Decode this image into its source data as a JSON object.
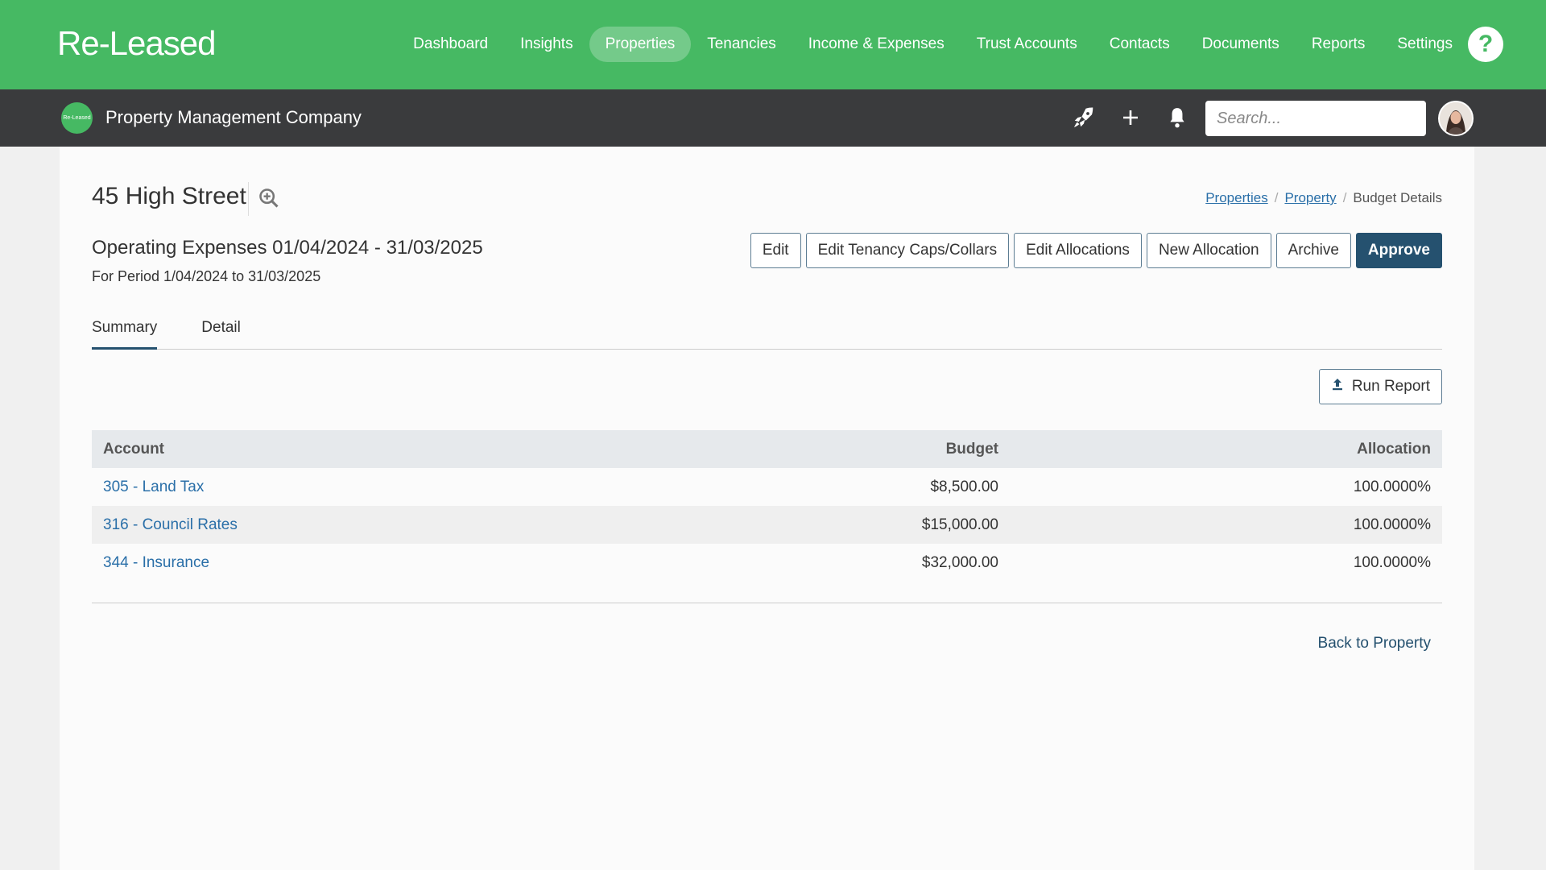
{
  "app": {
    "logo": "Re-Leased",
    "nav": [
      {
        "label": "Dashboard"
      },
      {
        "label": "Insights"
      },
      {
        "label": "Properties",
        "active": true
      },
      {
        "label": "Tenancies"
      },
      {
        "label": "Income & Expenses"
      },
      {
        "label": "Trust Accounts"
      },
      {
        "label": "Contacts"
      },
      {
        "label": "Documents"
      },
      {
        "label": "Reports"
      },
      {
        "label": "Settings"
      }
    ],
    "help_label": "?"
  },
  "subbar": {
    "company_logo_text": "Re-Leased",
    "company_name": "Property Management Company",
    "search_placeholder": "Search...",
    "icons": [
      "rocket-icon",
      "plus-icon",
      "bell-icon"
    ]
  },
  "page": {
    "property_title": "45 High Street",
    "breadcrumb": {
      "items": [
        "Properties",
        "Property"
      ],
      "current": "Budget Details"
    },
    "heading": "Operating Expenses 01/04/2024 - 31/03/2025",
    "period": "For Period 1/04/2024 to 31/03/2025",
    "actions": {
      "edit": "Edit",
      "edit_caps": "Edit Tenancy Caps/Collars",
      "edit_alloc": "Edit Allocations",
      "new_alloc": "New Allocation",
      "archive": "Archive",
      "approve": "Approve"
    },
    "tabs": {
      "summary": "Summary",
      "detail": "Detail"
    },
    "run_report": "Run Report",
    "table": {
      "headers": {
        "account": "Account",
        "budget": "Budget",
        "allocation": "Allocation"
      },
      "rows": [
        {
          "account": "305 - Land Tax",
          "budget": "$8,500.00",
          "allocation": "100.0000%"
        },
        {
          "account": "316 - Council Rates",
          "budget": "$15,000.00",
          "allocation": "100.0000%"
        },
        {
          "account": "344 - Insurance",
          "budget": "$32,000.00",
          "allocation": "100.0000%"
        }
      ]
    },
    "back_link": "Back to Property"
  },
  "colors": {
    "brand_green": "#46b963",
    "dark_bar": "#3a3b3d",
    "primary_blue": "#25516f",
    "link_blue": "#2a6fa8"
  }
}
